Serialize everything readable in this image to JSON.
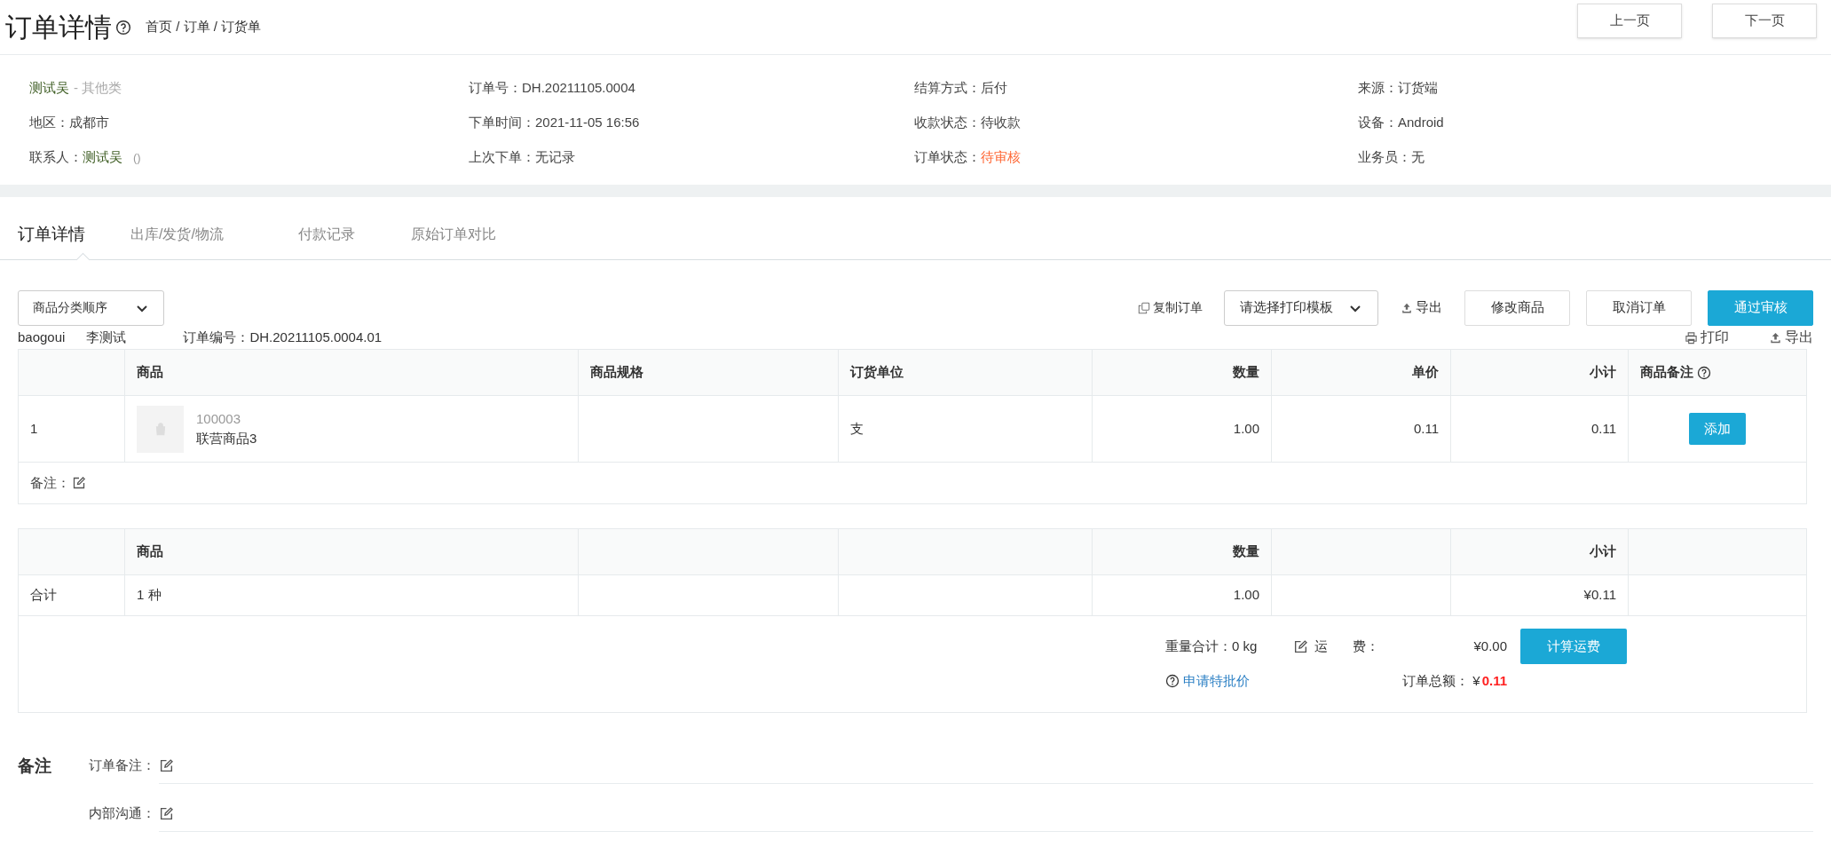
{
  "header": {
    "title": "订单详情",
    "breadcrumb": "首页 / 订单 / 订货单",
    "nav_buttons": [
      "上一页",
      "下一页"
    ]
  },
  "info": {
    "columns": [
      [
        {
          "kind": "name",
          "value": "测试吴",
          "suffix": "- 其他类"
        },
        {
          "kind": "field",
          "label": "地区：",
          "value": "成都市"
        },
        {
          "kind": "contact",
          "label": "联系人：",
          "value": "测试吴",
          "suffix": "()"
        }
      ],
      [
        {
          "kind": "field",
          "label": "订单号：",
          "value": "DH.20211105.0004"
        },
        {
          "kind": "field",
          "label": "下单时间：",
          "value": "2021-11-05 16:56"
        },
        {
          "kind": "field",
          "label": "上次下单：",
          "value": "无记录"
        }
      ],
      [
        {
          "kind": "field",
          "label": "结算方式：",
          "value": "后付"
        },
        {
          "kind": "field",
          "label": "收款状态：",
          "value": "待收款"
        },
        {
          "kind": "status",
          "label": "订单状态：",
          "value": "待审核"
        }
      ],
      [
        {
          "kind": "field",
          "label": "来源：",
          "value": "订货端"
        },
        {
          "kind": "field",
          "label": "设备：",
          "value": "Android"
        },
        {
          "kind": "field",
          "label": "业务员：",
          "value": "无"
        }
      ]
    ]
  },
  "tabs": [
    {
      "label": "订单详情",
      "selected": true
    },
    {
      "label": "出库/发货/物流",
      "selected": false
    },
    {
      "label": "付款记录",
      "selected": false
    },
    {
      "label": "原始订单对比",
      "selected": false
    }
  ],
  "toolbar": {
    "sort_select": "商品分类顺序",
    "copy_link": "复制订单",
    "print_template_select": "请选择打印模板",
    "export_link": "导出",
    "buttons": [
      {
        "label": "修改商品",
        "kind": "default"
      },
      {
        "label": "取消订单",
        "kind": "default"
      },
      {
        "label": "通过审核",
        "kind": "primary"
      }
    ]
  },
  "order_line": {
    "user": "baogoui",
    "name": "李测试",
    "order_no": "订单编号：DH.20211105.0004.01",
    "actions": [
      {
        "kind": "print",
        "label": "打印"
      },
      {
        "kind": "export",
        "label": "导出"
      }
    ]
  },
  "items_table": {
    "columns": [
      {},
      {
        "label": "商品"
      },
      {
        "label": "商品规格"
      },
      {
        "label": "订货单位"
      },
      {
        "label": "数量"
      },
      {
        "label": "单价"
      },
      {
        "label": "小计"
      },
      {
        "label": "商品备注",
        "help": true
      }
    ],
    "rows": [
      {
        "index": "1",
        "code": "100003",
        "name": "联营商品3",
        "unit": "支",
        "quantity": "1.00",
        "price": "0.11",
        "subtotal": "0.11",
        "remark_button": "添加"
      }
    ],
    "remark_label": "备注："
  },
  "totals_table": {
    "columns": [
      {},
      {
        "label": "商品"
      },
      {},
      {},
      {
        "label": "数量"
      },
      {},
      {
        "label": "小计"
      },
      {}
    ],
    "cells": [
      "合计",
      "1 种",
      "",
      "",
      "1.00",
      "",
      "¥0.11",
      ""
    ]
  },
  "summary": {
    "weight": "重量合计：0 kg",
    "freight_label_1": "运",
    "freight_label_2": "费：",
    "freight_value": "¥0.00",
    "calc_button": "计算运费",
    "special_price_link": "申请特批价",
    "total_label": "订单总额：",
    "total_currency": "¥",
    "total_value": "0.11"
  },
  "notes": {
    "title": "备注",
    "rows": [
      "订单备注：",
      "内部沟通："
    ]
  }
}
